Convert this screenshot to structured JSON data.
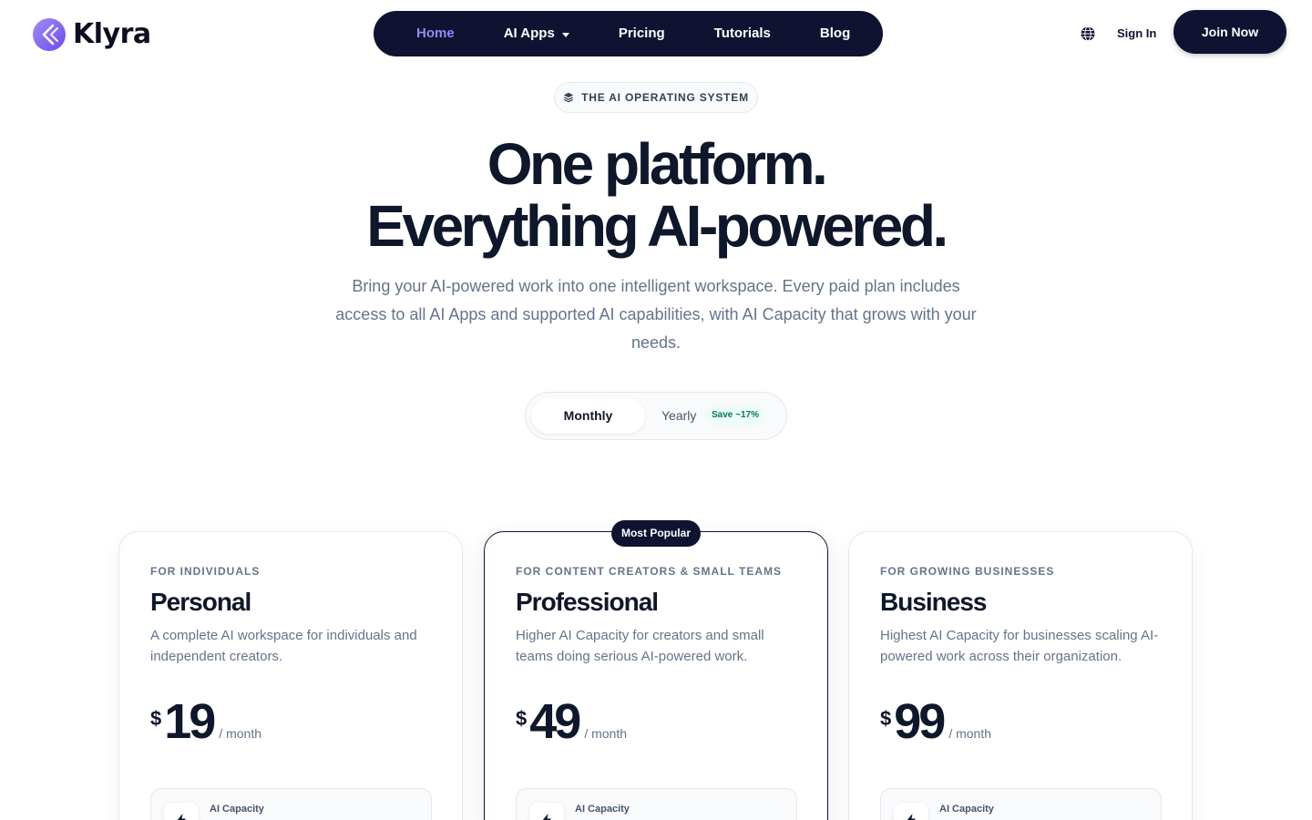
{
  "brand": {
    "name": "Klyra"
  },
  "nav": {
    "items": [
      {
        "label": "Home",
        "active": true
      },
      {
        "label": "AI Apps",
        "dropdown": true
      },
      {
        "label": "Pricing"
      },
      {
        "label": "Tutorials"
      },
      {
        "label": "Blog"
      }
    ]
  },
  "header": {
    "sign_in": "Sign In",
    "join": "Join Now",
    "language_icon": "globe-icon"
  },
  "hero": {
    "badge": "THE AI OPERATING SYSTEM",
    "title_line1": "One platform.",
    "title_line2": "Everything AI-powered.",
    "subtitle": "Bring your AI-powered work into one intelligent workspace. Every paid plan includes access to all AI Apps and supported AI capabilities, with AI Capacity that grows with your needs."
  },
  "billing": {
    "monthly": "Monthly",
    "yearly": "Yearly",
    "save": "Save ~17%",
    "selected": "Monthly"
  },
  "plans": [
    {
      "kicker": "FOR INDIVIDUALS",
      "name": "Personal",
      "description": "A complete AI workspace for individuals and independent creators.",
      "currency": "$",
      "price": "19",
      "period": "/ month",
      "capacity_label": "AI Capacity"
    },
    {
      "kicker": "FOR CONTENT CREATORS & SMALL TEAMS",
      "name": "Professional",
      "description": "Higher AI Capacity for creators and small teams doing serious AI-powered work.",
      "currency": "$",
      "price": "49",
      "period": "/ month",
      "capacity_label": "AI Capacity",
      "badge": "Most Popular"
    },
    {
      "kicker": "FOR GROWING BUSINESSES",
      "name": "Business",
      "description": "Highest AI Capacity for businesses scaling AI-powered work across their organization.",
      "currency": "$",
      "price": "99",
      "period": "/ month",
      "capacity_label": "AI Capacity"
    }
  ],
  "colors": {
    "navy": "#0f1331",
    "accent_purple": "#9a86f4",
    "logo_purple": "#7c5cf0",
    "save_green": "#047857"
  }
}
